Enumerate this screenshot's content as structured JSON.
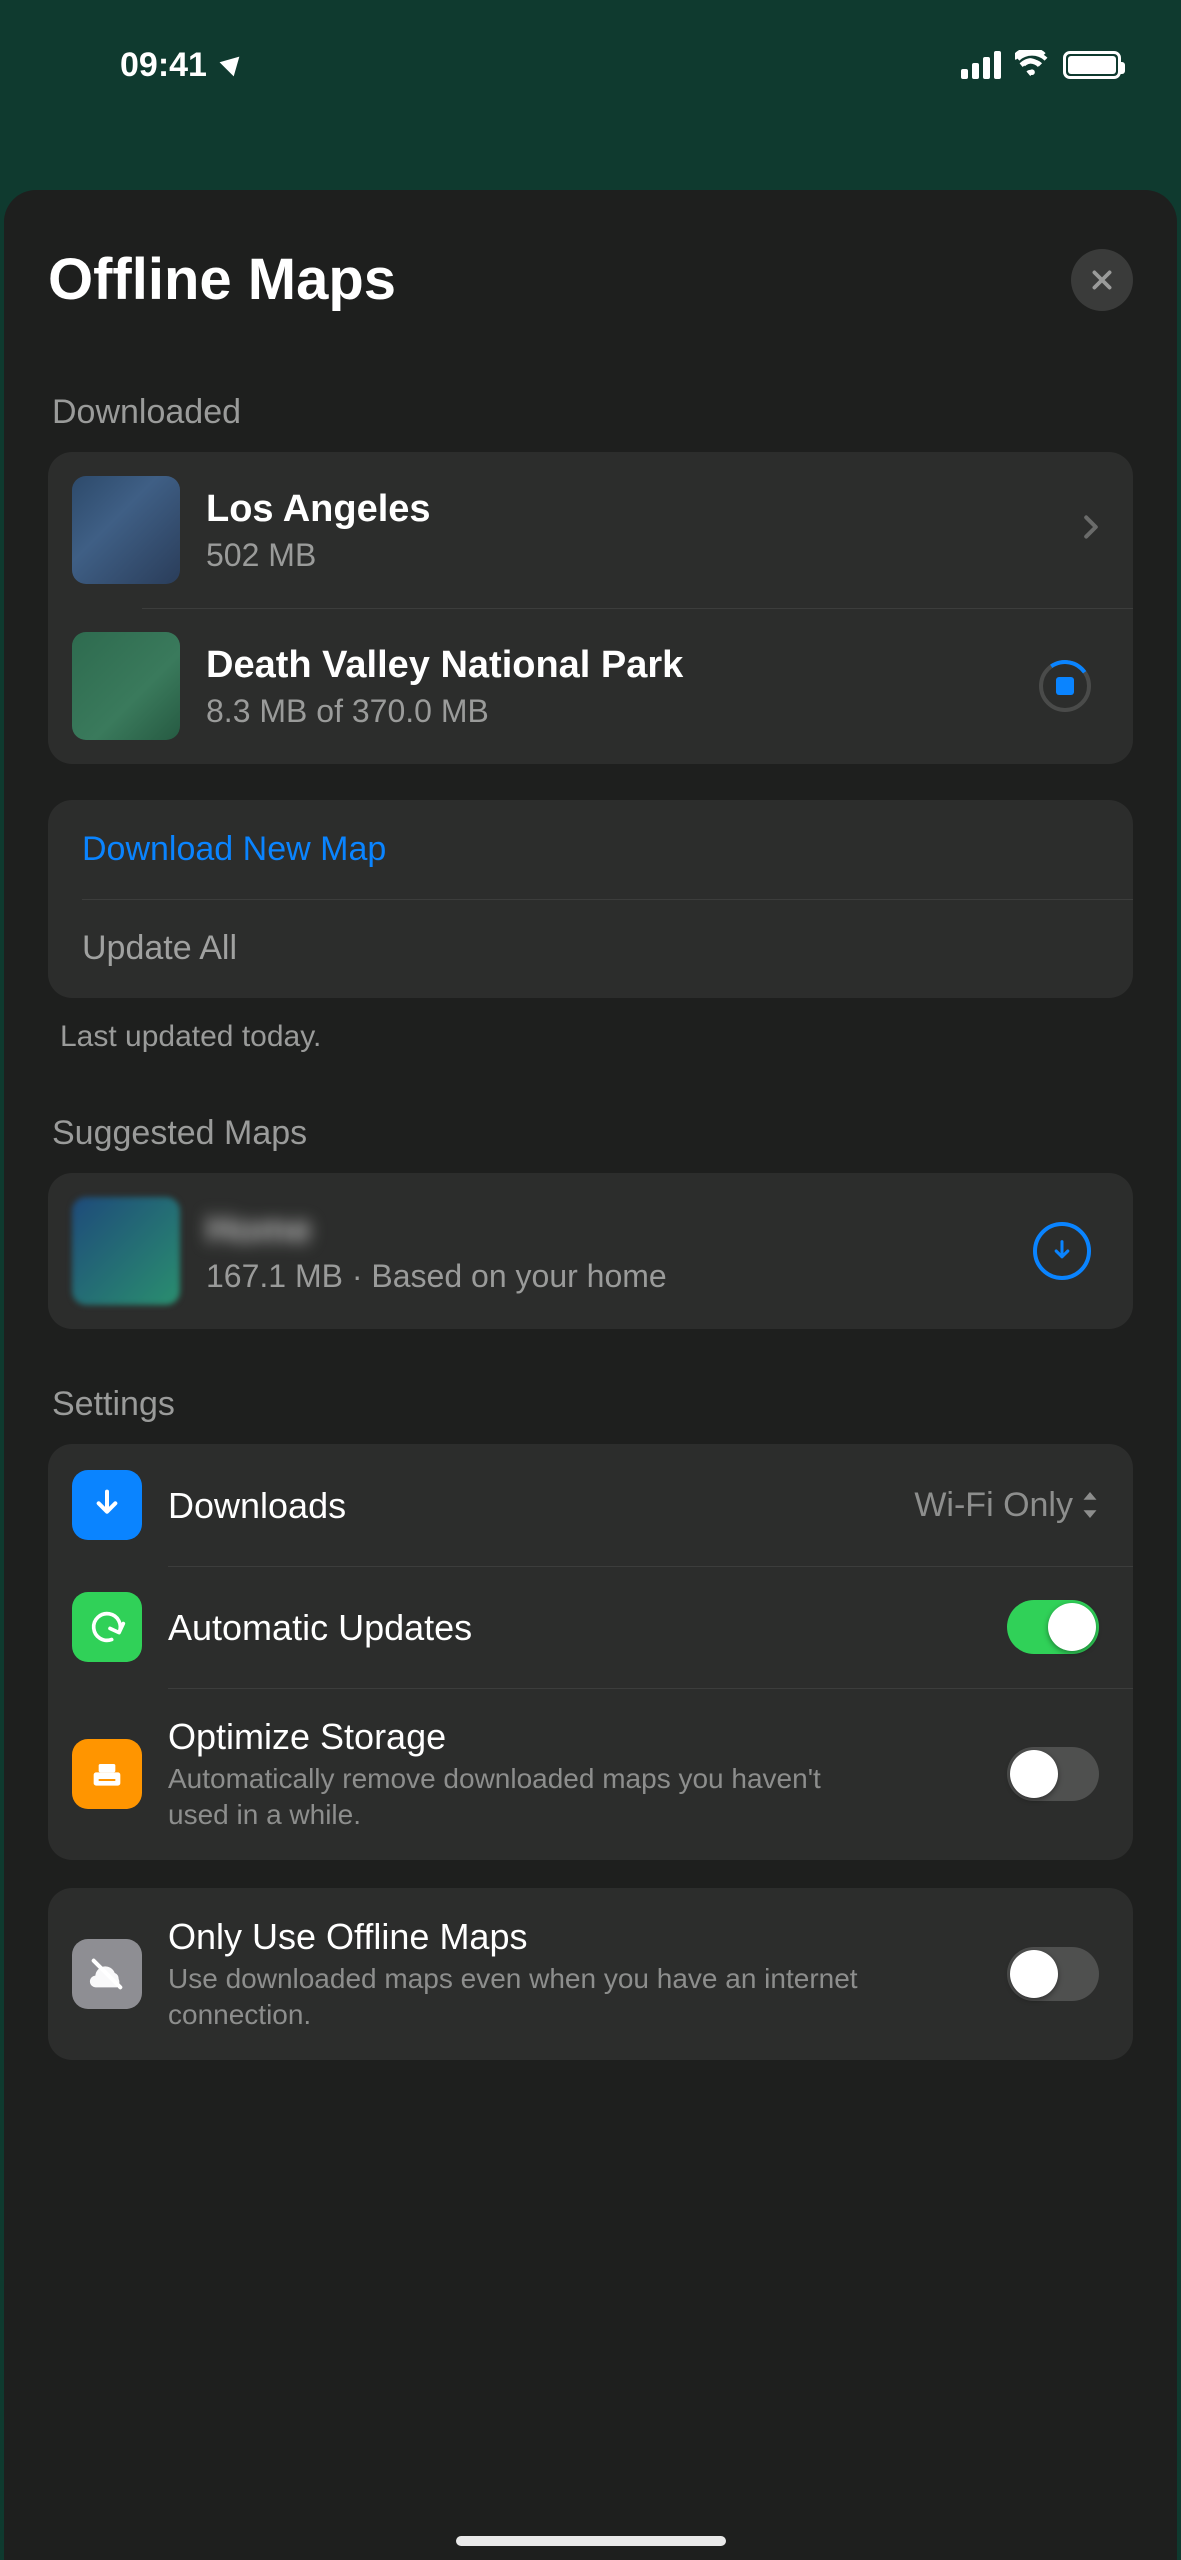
{
  "status": {
    "time": "09:41"
  },
  "sheet": {
    "title": "Offline Maps"
  },
  "downloaded": {
    "label": "Downloaded",
    "items": [
      {
        "name": "Los Angeles",
        "subtitle": "502 MB"
      },
      {
        "name": "Death Valley National Park",
        "subtitle": "8.3 MB of 370.0 MB"
      }
    ],
    "actions": {
      "download_new": "Download New Map",
      "update_all": "Update All"
    },
    "footer": "Last updated today."
  },
  "suggested": {
    "label": "Suggested Maps",
    "items": [
      {
        "name": "Home",
        "subtitle": "167.1 MB · Based on your home"
      }
    ]
  },
  "settings": {
    "label": "Settings",
    "downloads": {
      "title": "Downloads",
      "value": "Wi-Fi Only"
    },
    "auto_updates": {
      "title": "Automatic Updates",
      "on": true
    },
    "optimize": {
      "title": "Optimize Storage",
      "desc": "Automatically remove downloaded maps you haven't used in a while.",
      "on": false
    },
    "offline_only": {
      "title": "Only Use Offline Maps",
      "desc": "Use downloaded maps even when you have an internet connection.",
      "on": false
    }
  }
}
